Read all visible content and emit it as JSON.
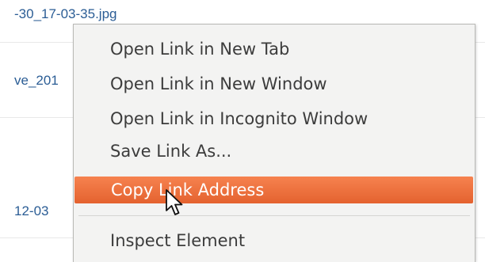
{
  "background": {
    "links": [
      "-30_17-03-35.jpg",
      "ve_201",
      "12-03"
    ]
  },
  "context_menu": {
    "items": [
      "Open Link in New Tab",
      "Open Link in New Window",
      "Open Link in Incognito Window",
      "Save Link As...",
      "Copy Link Address",
      "Inspect Element"
    ],
    "highlighted": "Copy Link Address",
    "highlight_color": "#ec6e3c"
  },
  "cursor": {
    "icon": "arrow-pointer-icon"
  }
}
